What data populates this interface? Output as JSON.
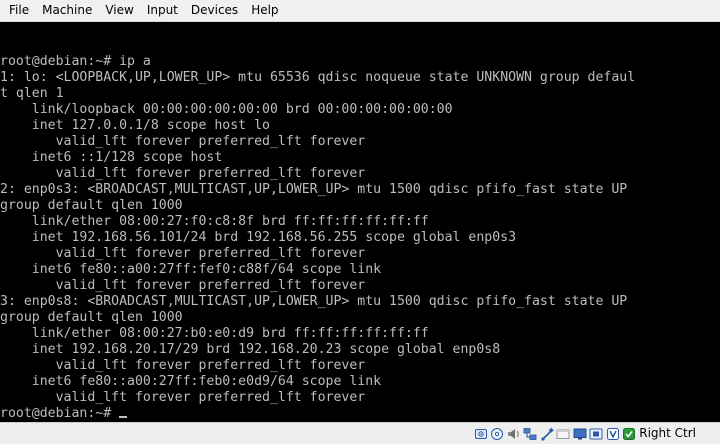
{
  "menubar": {
    "items": [
      "File",
      "Machine",
      "View",
      "Input",
      "Devices",
      "Help"
    ]
  },
  "terminal": {
    "lines": [
      "",
      "root@debian:~# ip a",
      "1: lo: <LOOPBACK,UP,LOWER_UP> mtu 65536 qdisc noqueue state UNKNOWN group defaul",
      "t qlen 1",
      "    link/loopback 00:00:00:00:00:00 brd 00:00:00:00:00:00",
      "    inet 127.0.0.1/8 scope host lo",
      "       valid_lft forever preferred_lft forever",
      "    inet6 ::1/128 scope host",
      "       valid_lft forever preferred_lft forever",
      "2: enp0s3: <BROADCAST,MULTICAST,UP,LOWER_UP> mtu 1500 qdisc pfifo_fast state UP",
      "group default qlen 1000",
      "    link/ether 08:00:27:f0:c8:8f brd ff:ff:ff:ff:ff:ff",
      "    inet 192.168.56.101/24 brd 192.168.56.255 scope global enp0s3",
      "       valid_lft forever preferred_lft forever",
      "    inet6 fe80::a00:27ff:fef0:c88f/64 scope link",
      "       valid_lft forever preferred_lft forever",
      "3: enp0s8: <BROADCAST,MULTICAST,UP,LOWER_UP> mtu 1500 qdisc pfifo_fast state UP",
      "group default qlen 1000",
      "    link/ether 08:00:27:b0:e0:d9 brd ff:ff:ff:ff:ff:ff",
      "    inet 192.168.20.17/29 brd 192.168.20.23 scope global enp0s8",
      "       valid_lft forever preferred_lft forever",
      "    inet6 fe80::a00:27ff:feb0:e0d9/64 scope link",
      "       valid_lft forever preferred_lft forever"
    ],
    "prompt": "root@debian:~# "
  },
  "statusbar": {
    "icons": [
      "hard-disk-icon",
      "optical-drive-icon",
      "audio-icon",
      "network-icon",
      "usb-icon",
      "shared-folders-icon",
      "display-icon",
      "video-capture-icon",
      "virtualization-icon",
      "mouse-integration-icon"
    ],
    "host_key": "Right Ctrl"
  },
  "colors": {
    "terminal_bg": "#000000",
    "terminal_fg": "#bdbdbd",
    "menubar_bg": "#f0f0f0",
    "statusbar_bg": "#eeeeee"
  }
}
